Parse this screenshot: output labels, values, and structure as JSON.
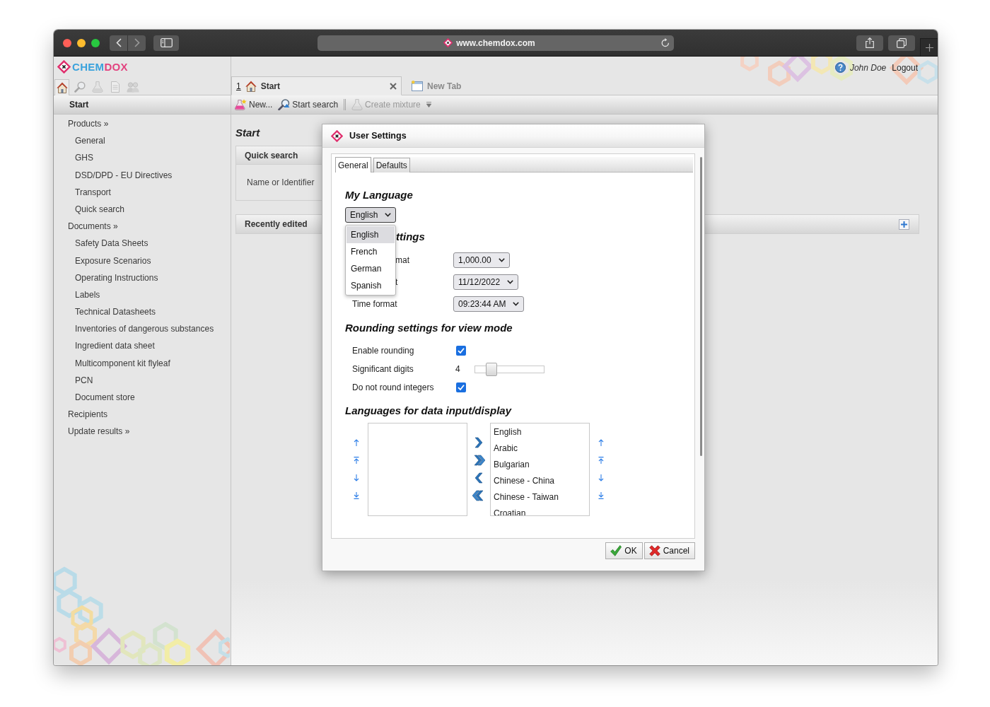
{
  "browser": {
    "url": "www.chemdox.com"
  },
  "app_header": {
    "logo": [
      "CHEM",
      "DOX"
    ],
    "user": "John Doe",
    "logout": "Logout"
  },
  "sidebar": {
    "icon_tabs": [
      {
        "kind": "home",
        "selected": true
      },
      {
        "kind": "search",
        "selected": false
      },
      {
        "kind": "flask",
        "selected": false
      },
      {
        "kind": "document",
        "selected": false
      },
      {
        "kind": "people",
        "selected": false
      }
    ],
    "title": "Start",
    "items": [
      {
        "label": "Products »",
        "children": [
          {
            "label": "General"
          },
          {
            "label": "GHS"
          },
          {
            "label": "DSD/DPD - EU Directives"
          },
          {
            "label": "Transport"
          },
          {
            "label": "Quick search"
          }
        ]
      },
      {
        "label": "Documents »",
        "children": [
          {
            "label": "Safety Data Sheets"
          },
          {
            "label": "Exposure Scenarios"
          },
          {
            "label": "Operating Instructions"
          },
          {
            "label": "Labels"
          },
          {
            "label": "Technical Datasheets"
          },
          {
            "label": "Inventories of dangerous substances"
          },
          {
            "label": "Ingredient data sheet"
          },
          {
            "label": "Multicomponent kit flyleaf"
          },
          {
            "label": "PCN"
          },
          {
            "label": "Document store"
          }
        ]
      },
      {
        "label": "Recipients"
      },
      {
        "label": "Update results »"
      }
    ]
  },
  "tabs": [
    {
      "kind": "page",
      "number": "1",
      "label": "Start",
      "closable": true,
      "selected": true
    },
    {
      "kind": "blank",
      "label": "New Tab",
      "closable": false,
      "selected": false
    }
  ],
  "toolbar": [
    {
      "kind": "new",
      "label": "New...",
      "disabled": false
    },
    {
      "kind": "search",
      "label": "Start search",
      "disabled": false
    },
    {
      "kind": "separator"
    },
    {
      "kind": "mixture",
      "label": "Create mixture",
      "disabled": true
    }
  ],
  "start_page": {
    "title": "Start",
    "panels": [
      {
        "kind": "search",
        "title": "Quick search",
        "field_label": "Name or Identifier"
      },
      {
        "kind": "list",
        "title": "Recently edited"
      }
    ]
  },
  "dialog": {
    "title": "User Settings",
    "tabs": [
      {
        "label": "General",
        "selected": true
      },
      {
        "label": "Defaults",
        "selected": false
      }
    ],
    "language": {
      "heading": "My Language",
      "value": "English",
      "expanded": true,
      "options": [
        {
          "label": "English",
          "selected": true
        },
        {
          "label": "French",
          "selected": false
        },
        {
          "label": "German",
          "selected": false
        },
        {
          "label": "Spanish",
          "selected": false
        }
      ]
    },
    "format": {
      "heading": "ttings",
      "heading_covered": true,
      "rows": [
        {
          "kind": "covered",
          "label": "mat",
          "value": "1,000.00"
        },
        {
          "kind": "covered",
          "label": "t",
          "value": "11/12/2022"
        },
        {
          "kind": "plain",
          "label": "Time format",
          "value": "09:23:44 AM"
        }
      ]
    },
    "rounding": {
      "heading": "Rounding settings for view mode",
      "rows": [
        {
          "kind": "checkbox",
          "label": "Enable rounding",
          "checked": true
        },
        {
          "kind": "slider",
          "label": "Significant digits",
          "reading": "4",
          "level": 0.24
        },
        {
          "kind": "checkbox",
          "label": "Do not round integers",
          "checked": true
        }
      ]
    },
    "languages": {
      "heading": "Languages for data input/display",
      "selected_list": [
        "English",
        "Arabic",
        "Bulgarian",
        "Chinese - China",
        "Chinese - Taiwan",
        "Croatian"
      ]
    },
    "buttons": [
      {
        "kind": "ok",
        "label": "OK"
      },
      {
        "kind": "cancel",
        "label": "Cancel"
      }
    ]
  }
}
